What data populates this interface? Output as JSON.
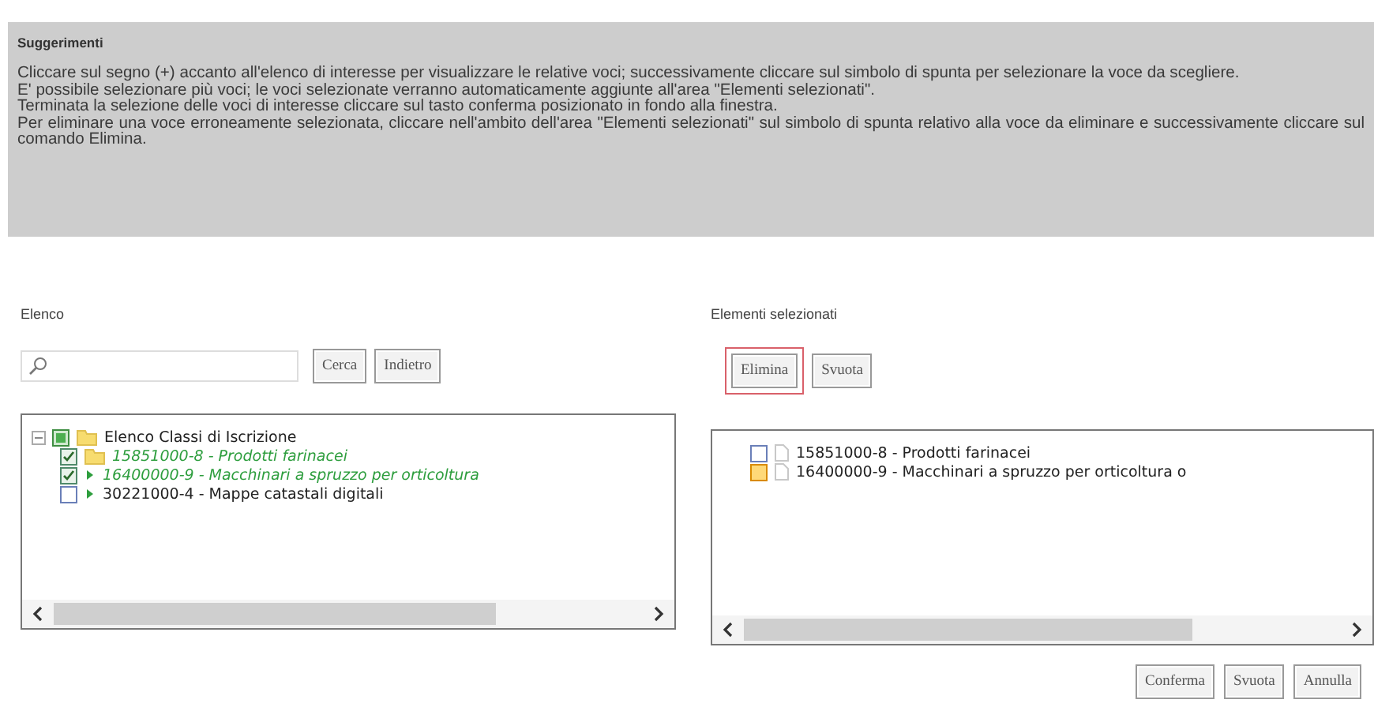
{
  "hints": {
    "title": "Suggerimenti",
    "paragraphs": [
      "Cliccare sul segno (+) accanto all'elenco di interesse per visualizzare le relative voci; successivamente cliccare sul simbolo di spunta per selezionare la voce da scegliere.",
      "E' possibile selezionare più voci; le voci selezionate verranno automaticamente aggiunte all'area \"Elementi selezionati\".",
      "Terminata la selezione delle voci di interesse cliccare sul tasto conferma posizionato in fondo alla finestra.",
      "Per eliminare una voce erroneamente selezionata, cliccare nell'ambito dell'area \"Elementi selezionati\" sul simbolo di spunta relativo alla voce da eliminare e successivamente cliccare sul comando Elimina."
    ]
  },
  "list_panel": {
    "label": "Elenco",
    "buttons": [
      "Cerca",
      "Indietro"
    ],
    "tree": {
      "label": "Elenco Classi di Iscrizione",
      "expanded": true,
      "indeterminate": true,
      "children": [
        {
          "label": "15851000-8 - Prodotti farinacei",
          "kind": "folder",
          "checked": true
        },
        {
          "label": "16400000-9 - Macchinari a spruzzo per orticoltura",
          "kind": "leaf",
          "checked": true
        },
        {
          "label": "30221000-4 - Mappe catastali digitali",
          "kind": "leaf",
          "checked": false
        }
      ]
    }
  },
  "selected_panel": {
    "label": "Elementi selezionati",
    "buttons": [
      {
        "label": "Elimina",
        "highlighted": true
      },
      {
        "label": "Svuota",
        "highlighted": false
      }
    ],
    "items": [
      {
        "label": "15851000-8 - Prodotti farinacei",
        "selected": false
      },
      {
        "label": "16400000-9 - Macchinari a spruzzo per orticoltura o",
        "selected": true
      }
    ]
  },
  "footer_buttons": [
    "Conferma",
    "Svuota",
    "Annulla"
  ]
}
